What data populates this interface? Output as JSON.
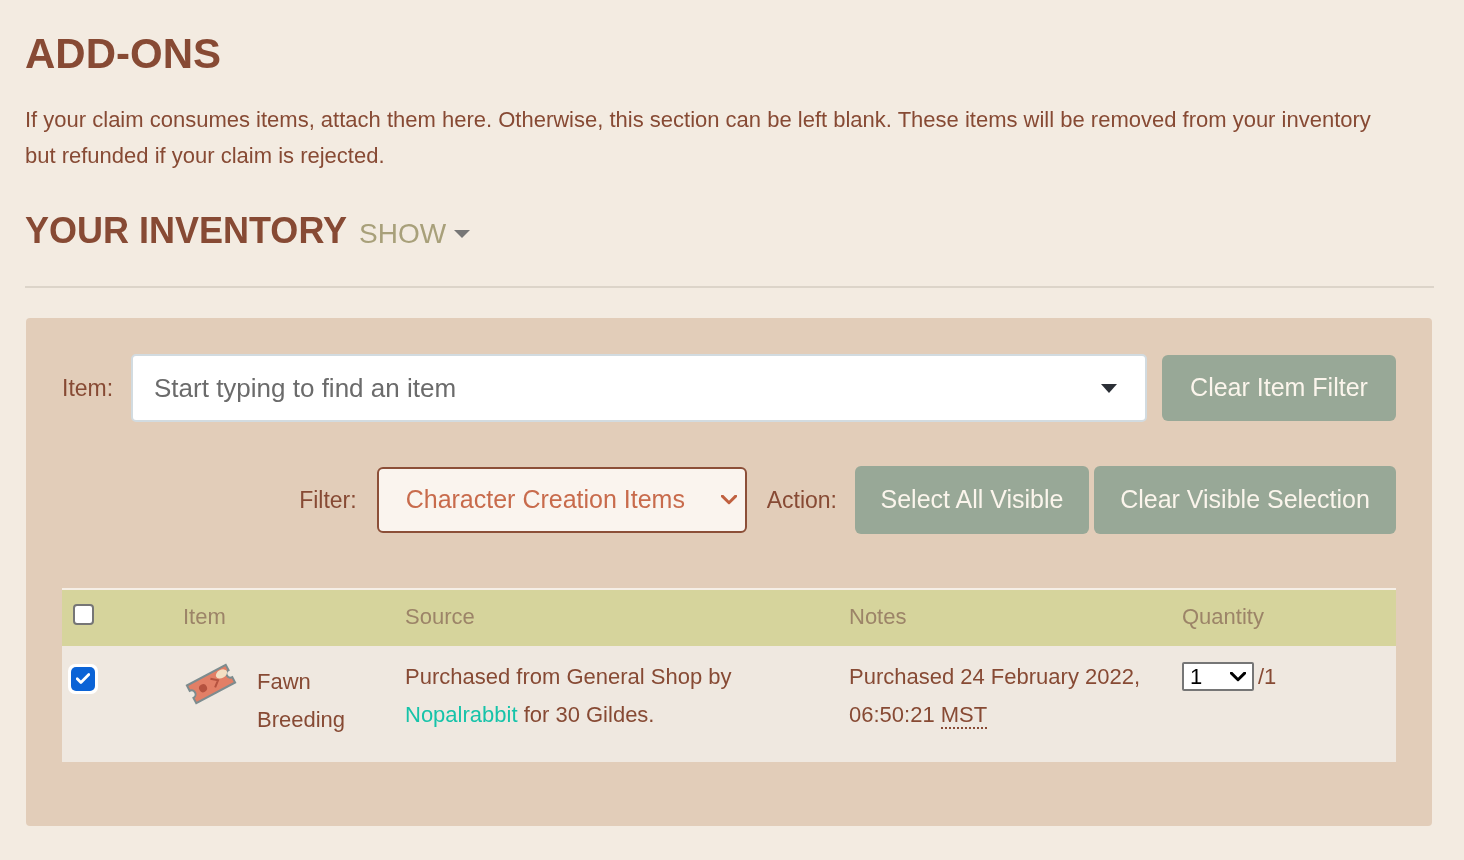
{
  "title": "ADD-ONS",
  "description": "If your claim consumes items, attach them here. Otherwise, this section can be left blank. These items will be removed from your inventory but refunded if your claim is rejected.",
  "inventory": {
    "title": "YOUR INVENTORY",
    "toggle": "SHOW"
  },
  "item_filter": {
    "label": "Item:",
    "placeholder": "Start typing to find an item",
    "clear_button": "Clear Item Filter"
  },
  "filter": {
    "label": "Filter:",
    "value": "Character Creation Items"
  },
  "action": {
    "label": "Action:",
    "buttons": [
      "Select All Visible",
      "Clear Visible Selection"
    ]
  },
  "table": {
    "select_all_checked": false,
    "columns": [
      "Item",
      "Source",
      "Notes",
      "Quantity"
    ],
    "rows": [
      {
        "checked": true,
        "item": "Fawn Breeding",
        "source": {
          "prefix": "Purchased from General Shop by",
          "user": "Nopalrabbit",
          "suffix": "for 30 Gildes."
        },
        "notes": {
          "text": "Purchased 24 February 2022, 06:50:21",
          "timezone": "MST"
        },
        "quantity": "1",
        "available": "/1"
      }
    ]
  }
}
